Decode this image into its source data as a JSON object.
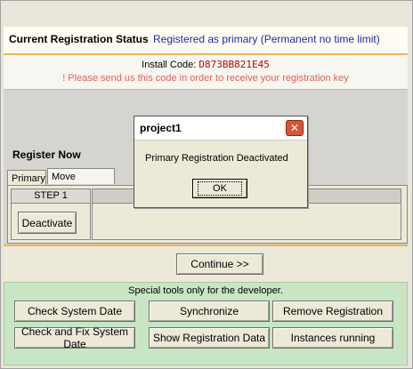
{
  "status": {
    "label": "Current Registration Status",
    "value": "Registered as primary (Permanent no time limit)"
  },
  "install": {
    "label": "Install Code:",
    "code": "D873BB821E45",
    "note": "!  Please send us this code in order to receive your registration key"
  },
  "register": {
    "heading": "Register Now",
    "tabs": [
      {
        "label": "Primary",
        "selected": false
      },
      {
        "label": "Move Primary",
        "selected": true
      }
    ],
    "step_label": "STEP 1",
    "deactivate_label": "Deactivate"
  },
  "continue_label": "Continue >>",
  "developer": {
    "caption": "Special tools only for the developer.",
    "buttons": [
      "Check System Date",
      "Synchronize",
      "Remove Registration",
      "Check and Fix System Date",
      "Show Registration Data",
      "Instances running"
    ]
  },
  "dialog": {
    "title": "project1",
    "message": "Primary Registration Deactivated",
    "ok_label": "OK",
    "close_icon": "close-icon"
  },
  "colors": {
    "status_value": "#1d2aa8",
    "install_code": "#a50c0c",
    "note": "#e0605a",
    "developer_bg": "#c8e6c3",
    "accent_line": "#e8b45a"
  }
}
